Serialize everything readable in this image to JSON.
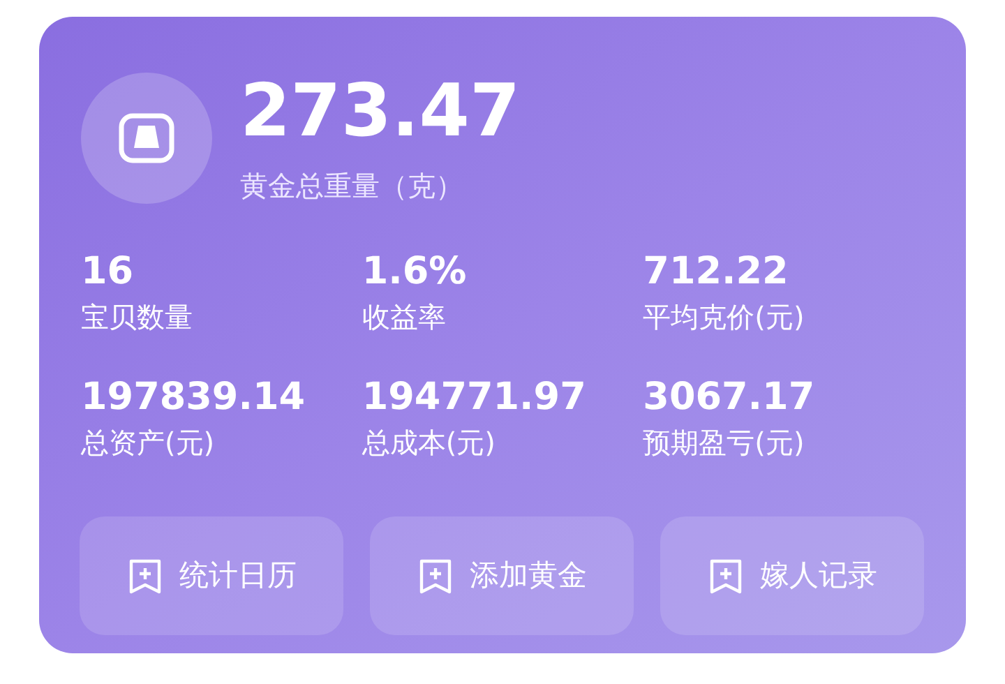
{
  "summary": {
    "value": "273.47",
    "label": "黄金总重量（克）"
  },
  "stats": [
    {
      "value": "16",
      "label": "宝贝数量"
    },
    {
      "value": "1.6%",
      "label": "收益率"
    },
    {
      "value": "712.22",
      "label": "平均克价(元)"
    },
    {
      "value": "197839.14",
      "label": "总资产(元)"
    },
    {
      "value": "194771.97",
      "label": "总成本(元)"
    },
    {
      "value": "3067.17",
      "label": "预期盈亏(元)"
    }
  ],
  "actions": [
    {
      "label": "统计日历"
    },
    {
      "label": "添加黄金"
    },
    {
      "label": "嫁人记录"
    }
  ]
}
